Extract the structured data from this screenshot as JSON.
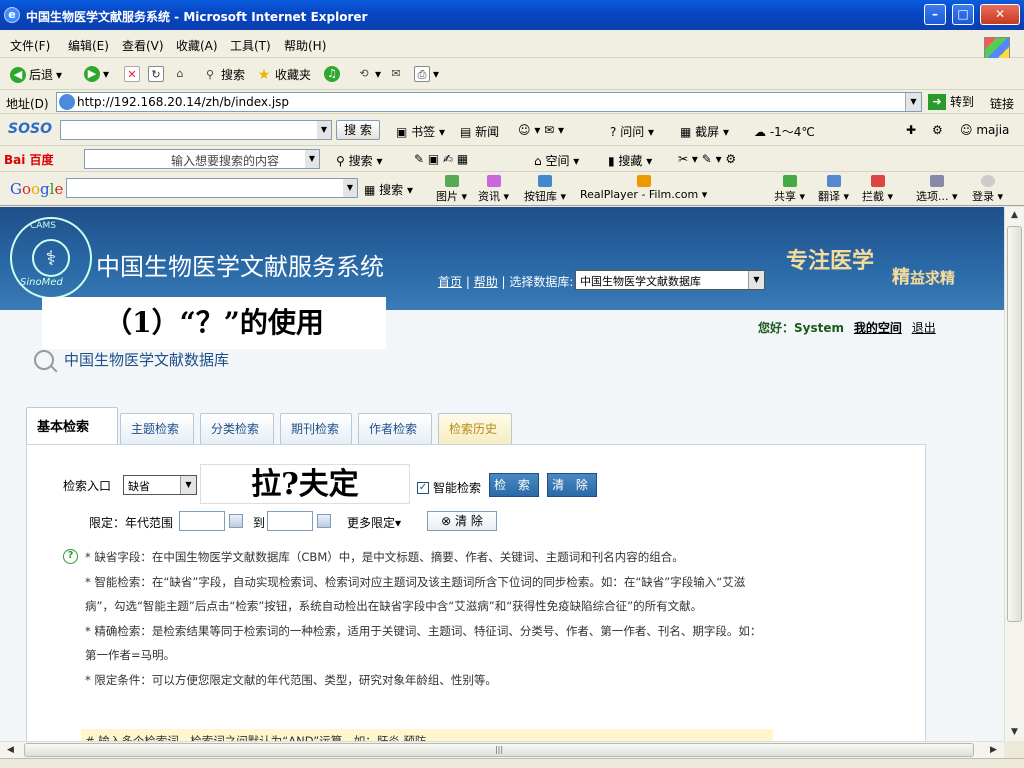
{
  "window": {
    "title": "中国生物医学文献服务系统 - Microsoft Internet Explorer",
    "min_glyph": "–",
    "max_glyph": "□",
    "close_glyph": "✕"
  },
  "menu": [
    "文件(F)",
    "编辑(E)",
    "查看(V)",
    "收藏(A)",
    "工具(T)",
    "帮助(H)"
  ],
  "toolbar": {
    "back": "后退",
    "search": "搜索",
    "favorites": "收藏夹"
  },
  "address": {
    "label": "地址(D)",
    "url": "http://192.168.20.14/zh/b/index.jsp",
    "go": "转到",
    "links": "链接"
  },
  "soso": {
    "logo": "SOSO",
    "search_button": "搜 索",
    "items": [
      "书签",
      "新闻",
      "问问",
      "截屏",
      "-1～4℃",
      "majia"
    ]
  },
  "baidu": {
    "logo": "Bai 百度",
    "placeholder": "输入想要搜索的内容",
    "items": [
      "搜索",
      "空间",
      "搜藏"
    ]
  },
  "google": {
    "logo": [
      "G",
      "o",
      "o",
      "g",
      "l",
      "e"
    ],
    "search": "搜索",
    "items": [
      "图片",
      "资讯",
      "按钮库",
      "RealPlayer - Film.com",
      "共享",
      "翻译",
      "拦截",
      "选项...",
      "登录"
    ]
  },
  "banner": {
    "seal_top": "CAMS",
    "seal_bottom": "SinoMed",
    "system_title": "中国生物医学文献服务系统",
    "nav_home": "首页",
    "nav_help": "帮助",
    "nav_select_label": "选择数据库:",
    "db_selected": "中国生物医学文献数据库",
    "slogan_main": "专注医学",
    "slogan_sub1": "精",
    "slogan_sub2": "益求精"
  },
  "caption": "（1）“？”的使用",
  "greeting": {
    "hello": "您好：",
    "user": "System",
    "my_space": "我的空间",
    "logout": "退出"
  },
  "db_heading": "中国生物医学文献数据库",
  "tabs": [
    "基本检索",
    "主题检索",
    "分类检索",
    "期刊检索",
    "作者检索",
    "检索历史"
  ],
  "form": {
    "entry_label": "检索入口",
    "entry_value": "缺省",
    "query": "拉?夫定",
    "smart_label": "智能检索",
    "smart_checked": true,
    "search_btn": "检 索",
    "clear_btn": "清 除",
    "limit_label": "限定：年代范围",
    "to": "到",
    "more_limits": "更多限定▾",
    "clear_limits": "⊗ 清 除"
  },
  "help": [
    "* 缺省字段：在中国生物医学文献数据库（CBM）中，是中文标题、摘要、作者、关键词、主题词和刊名内容的组合。",
    "* 智能检索：在“缺省”字段，自动实现检索词、检索词对应主题词及该主题词所含下位词的同步检索。如：在“缺省”字段输入“艾滋病”，勾选“智能主题”后点击“检索”按钮，系统自动检出在缺省字段中含“艾滋病”和“获得性免疫缺陷综合征”的所有文献。",
    "* 精确检索：是检索结果等同于检索词的一种检索，适用于关键词、主题词、特征词、分类号、作者、第一作者、刊名、期字段。如：第一作者=马明。",
    "* 限定条件：可以方便您限定文献的年代范围、类型，研究对象年龄组、性别等。"
  ],
  "note": "# 输入多个检索词，检索词之间默认为“AND”运算。如：肝炎 预防。",
  "colors": {
    "banner": "#2a6aa8",
    "accent_button": "#2a6aa8",
    "slogan": "#f6dc9a",
    "note_bg": "#fff6d0"
  }
}
